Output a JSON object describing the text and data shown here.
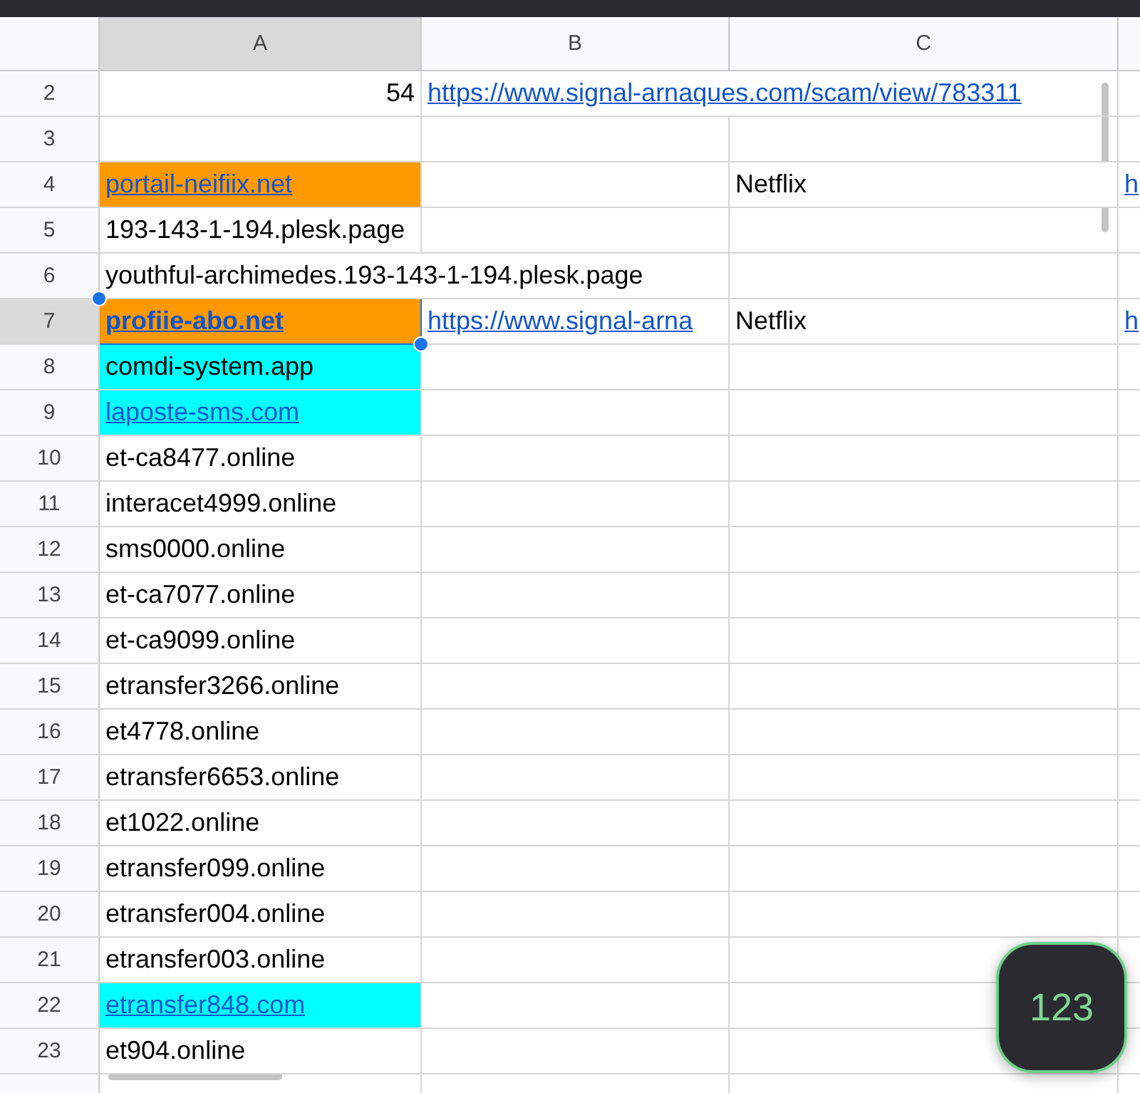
{
  "columns": [
    {
      "label": "A",
      "selected": true
    },
    {
      "label": "B",
      "selected": false
    },
    {
      "label": "C",
      "selected": false
    }
  ],
  "rows": [
    {
      "number": "2",
      "selected": false,
      "cells": {
        "A": {
          "text": "54",
          "kind": "number"
        },
        "B": {
          "text": "https://www.signal-arnaques.com/scam/view/783311",
          "kind": "link"
        }
      }
    },
    {
      "number": "3",
      "selected": false,
      "cells": {}
    },
    {
      "number": "4",
      "selected": false,
      "cells": {
        "A": {
          "text": "portail-neifiix.net",
          "kind": "link",
          "color": "#ff9900"
        },
        "C": {
          "text": "Netflix",
          "kind": "text"
        },
        "D": {
          "text": "h",
          "kind": "link"
        }
      }
    },
    {
      "number": "5",
      "selected": false,
      "cells": {
        "A": {
          "text": "193-143-1-194.plesk.page",
          "kind": "text"
        }
      }
    },
    {
      "number": "6",
      "selected": false,
      "cells": {
        "A": {
          "text": "youthful-archimedes.193-143-1-194.plesk.page",
          "kind": "text"
        }
      }
    },
    {
      "number": "7",
      "selected": true,
      "cells": {
        "A": {
          "text": "profiie-abo.net",
          "kind": "link",
          "color": "#ff9900",
          "bold": true
        },
        "B": {
          "text": "https://www.signal-arna",
          "kind": "link"
        },
        "C": {
          "text": "Netflix",
          "kind": "text"
        },
        "D": {
          "text": "h",
          "kind": "link"
        }
      }
    },
    {
      "number": "8",
      "selected": false,
      "cells": {
        "A": {
          "text": "comdi-system.app",
          "kind": "text",
          "color": "#00ffff"
        }
      }
    },
    {
      "number": "9",
      "selected": false,
      "cells": {
        "A": {
          "text": "laposte-sms.com",
          "kind": "link",
          "color": "#00ffff"
        }
      }
    },
    {
      "number": "10",
      "selected": false,
      "cells": {
        "A": {
          "text": "et-ca8477.online",
          "kind": "text"
        }
      }
    },
    {
      "number": "11",
      "selected": false,
      "cells": {
        "A": {
          "text": "interacet4999.online",
          "kind": "text"
        }
      }
    },
    {
      "number": "12",
      "selected": false,
      "cells": {
        "A": {
          "text": "sms0000.online",
          "kind": "text"
        }
      }
    },
    {
      "number": "13",
      "selected": false,
      "cells": {
        "A": {
          "text": "et-ca7077.online",
          "kind": "text"
        }
      }
    },
    {
      "number": "14",
      "selected": false,
      "cells": {
        "A": {
          "text": "et-ca9099.online",
          "kind": "text"
        }
      }
    },
    {
      "number": "15",
      "selected": false,
      "cells": {
        "A": {
          "text": "etransfer3266.online",
          "kind": "text"
        }
      }
    },
    {
      "number": "16",
      "selected": false,
      "cells": {
        "A": {
          "text": "et4778.online",
          "kind": "text"
        }
      }
    },
    {
      "number": "17",
      "selected": false,
      "cells": {
        "A": {
          "text": "etransfer6653.online",
          "kind": "text"
        }
      }
    },
    {
      "number": "18",
      "selected": false,
      "cells": {
        "A": {
          "text": "et1022.online",
          "kind": "text"
        }
      }
    },
    {
      "number": "19",
      "selected": false,
      "cells": {
        "A": {
          "text": "etransfer099.online",
          "kind": "text"
        }
      }
    },
    {
      "number": "20",
      "selected": false,
      "cells": {
        "A": {
          "text": "etransfer004.online",
          "kind": "text"
        }
      }
    },
    {
      "number": "21",
      "selected": false,
      "cells": {
        "A": {
          "text": "etransfer003.online",
          "kind": "text"
        }
      }
    },
    {
      "number": "22",
      "selected": false,
      "cells": {
        "A": {
          "text": "etransfer848.com",
          "kind": "link",
          "color": "#00ffff"
        }
      }
    },
    {
      "number": "23",
      "selected": false,
      "cells": {
        "A": {
          "text": "et904.online",
          "kind": "text"
        }
      }
    }
  ],
  "keyboard_button": {
    "label": "123"
  }
}
